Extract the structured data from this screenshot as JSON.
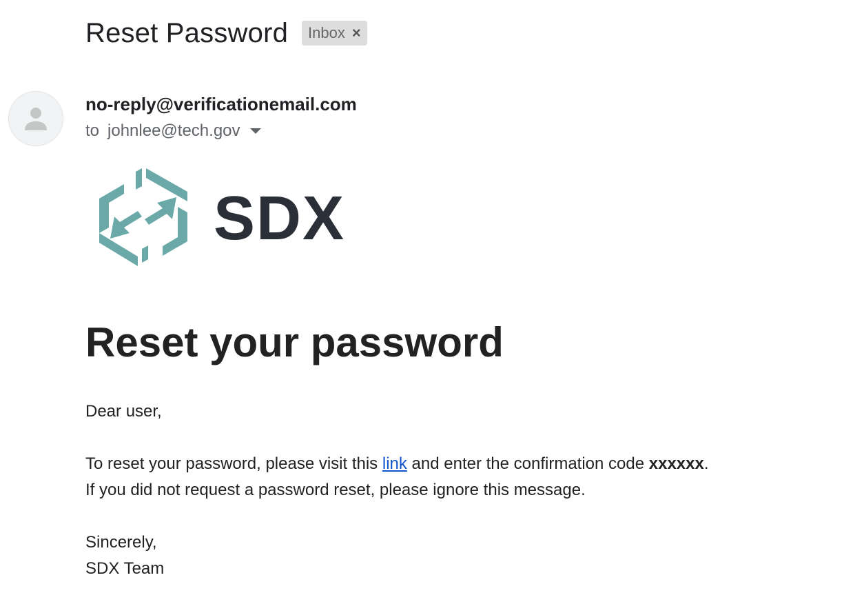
{
  "email": {
    "subject": "Reset Password",
    "label_chip": "Inbox",
    "label_close_glyph": "×",
    "sender": "no-reply@verificationemail.com",
    "to_label": "to",
    "recipient": "johnlee@tech.gov"
  },
  "logo": {
    "text": "SDX",
    "icon_color": "#6aa9a8",
    "text_color": "#2b2f38"
  },
  "body": {
    "heading": "Reset your password",
    "greeting": "Dear user,",
    "line1_before_link": "To reset your password, please visit this ",
    "link_text": "link",
    "line1_after_link": " and enter the confirmation code ",
    "confirmation_code": "xxxxxx",
    "line1_end": ".",
    "line2": "If you did not request a password reset, please ignore this message.",
    "closing": "Sincerely,",
    "signature": "SDX Team"
  },
  "colors": {
    "link": "#1155cc",
    "chip_background": "#dddddd"
  }
}
